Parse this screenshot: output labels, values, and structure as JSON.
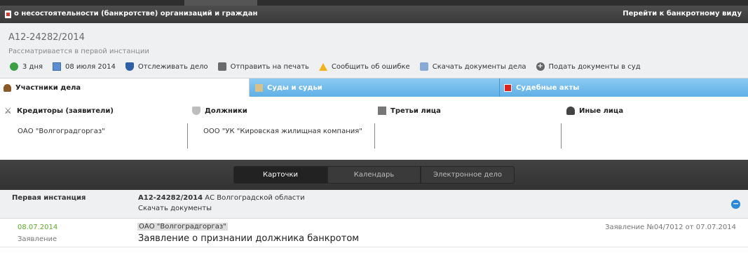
{
  "header": {
    "title": "о несостоятельности (банкротстве) организаций и граждан",
    "goto_link": "Перейти к банкротному виду"
  },
  "case": {
    "number": "А12-24282/2014",
    "status": "Рассматривается в первой инстанции"
  },
  "actions": [
    {
      "icon": "clock-icon",
      "label": "3 дня"
    },
    {
      "icon": "calendar-icon",
      "label": "08 июля 2014"
    },
    {
      "icon": "shield-icon",
      "label": "Отслеживать дело"
    },
    {
      "icon": "printer-icon",
      "label": "Отправить на печать"
    },
    {
      "icon": "warning-icon",
      "label": "Сообщить об ошибке"
    },
    {
      "icon": "download-icon",
      "label": "Скачать документы дела"
    },
    {
      "icon": "plus-icon",
      "label": "Подать документы в суд"
    }
  ],
  "tabs": [
    {
      "label": "Участники дела",
      "icon": "person-icon"
    },
    {
      "label": "Суды и судьи",
      "icon": "court-icon"
    },
    {
      "label": "Судебные акты",
      "icon": "pdf-icon"
    }
  ],
  "parties": [
    {
      "header": "Кредиторы (заявители)",
      "icon": "swords-icon",
      "value": "ОАО \"Волгоградгоргаз\""
    },
    {
      "header": "Должники",
      "icon": "shield-icon",
      "value": "ООО \"УК \"Кировская жилищная компания\""
    },
    {
      "header": "Третьи лица",
      "icon": "building-icon",
      "value": ""
    },
    {
      "header": "Иные лица",
      "icon": "person-icon",
      "value": ""
    }
  ],
  "view_switch": [
    "Карточки",
    "Календарь",
    "Электронное дело"
  ],
  "instance": {
    "label": "Первая инстанция",
    "case_number": "А12-24282/2014",
    "court": "АС Волгоградской области",
    "download": "Скачать документы"
  },
  "event": {
    "date": "08.07.2014",
    "type": "Заявление",
    "party": "ОАО \"Волгоградгоргаз\"",
    "description": "Заявление о признании должника банкротом",
    "reference": "Заявление №04/7012 от 07.07.2014"
  },
  "colors": {
    "tab_blue": "#5fb0e6",
    "date_green": "#5fa82a",
    "dark_bar": "#3a3a3a"
  }
}
